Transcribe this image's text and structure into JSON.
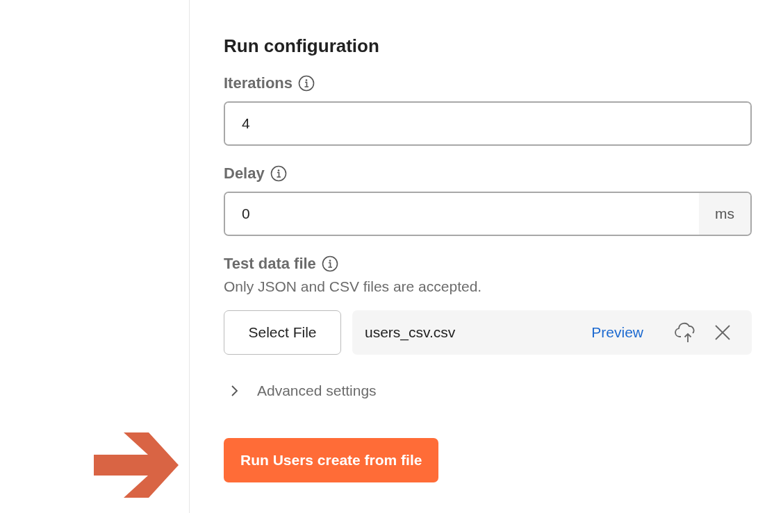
{
  "section_title": "Run configuration",
  "fields": [
    {
      "label": "Iterations",
      "value": "4"
    },
    {
      "label": "Delay",
      "value": "0",
      "unit": "ms"
    }
  ],
  "test_data": {
    "label": "Test data file",
    "hint": "Only JSON and CSV files are accepted.",
    "select_button": "Select File",
    "file_name": "users_csv.csv",
    "preview_link": "Preview"
  },
  "advanced": {
    "label": "Advanced settings",
    "expanded": false
  },
  "run_button": "Run Users create from file"
}
